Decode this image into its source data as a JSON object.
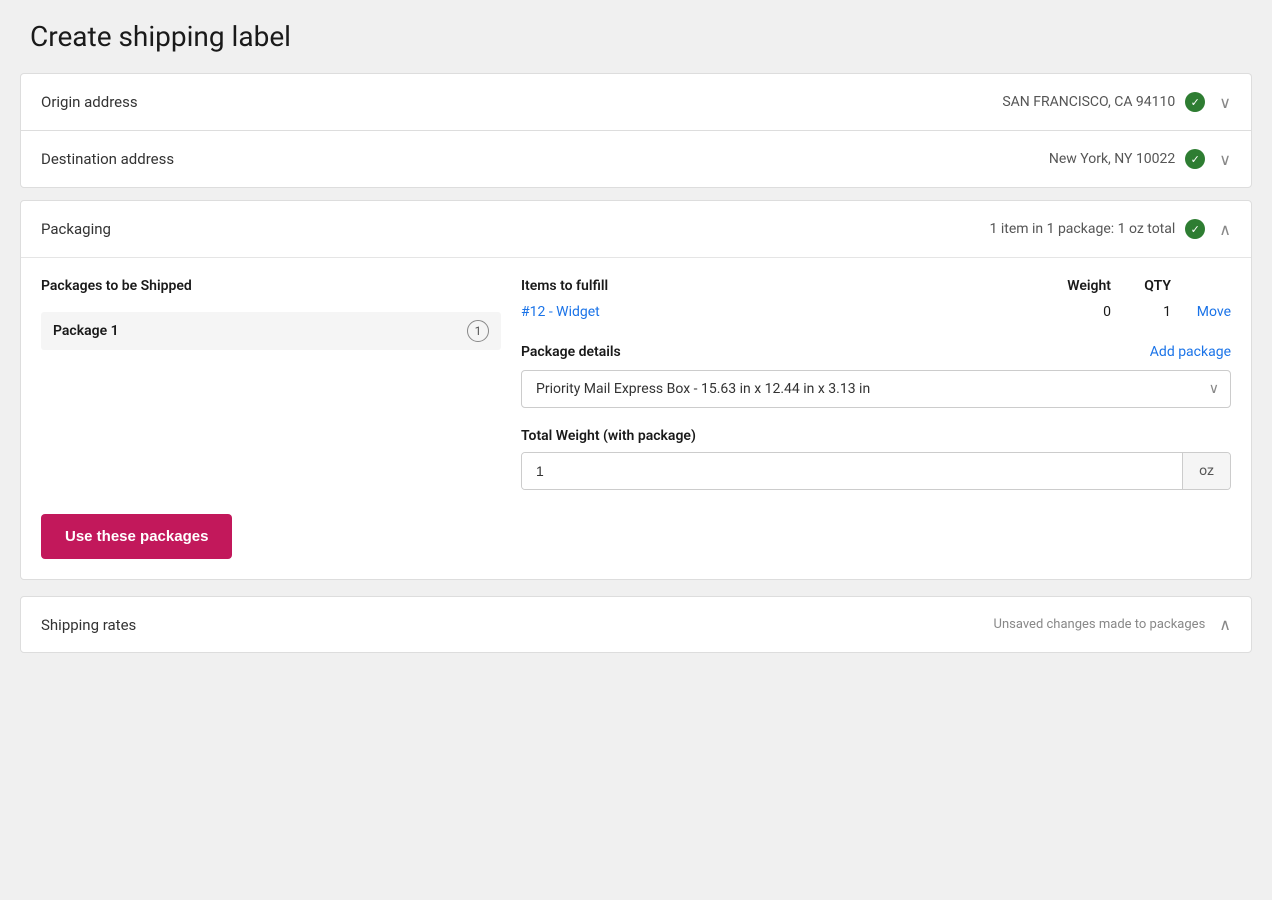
{
  "page": {
    "title": "Create shipping label"
  },
  "origin": {
    "label": "Origin address",
    "value": "SAN FRANCISCO, CA  94110",
    "verified": true
  },
  "destination": {
    "label": "Destination address",
    "value": "New York, NY  10022",
    "verified": true
  },
  "packaging": {
    "label": "Packaging",
    "summary": "1 item in 1 package: 1 oz total",
    "verified": true,
    "columns": {
      "packages": "Packages to be Shipped",
      "items": "Items to fulfill",
      "weight": "Weight",
      "qty": "QTY"
    },
    "package1": {
      "name": "Package 1",
      "badge": "1",
      "item": {
        "link": "#12 - Widget",
        "weight": "0",
        "qty": "1",
        "action": "Move"
      }
    },
    "details": {
      "label": "Package details",
      "addPackage": "Add package",
      "selectedBox": "Priority Mail Express Box - 15.63 in x 12.44 in x 3.13 in"
    },
    "totalWeight": {
      "label": "Total Weight (with package)",
      "value": "1",
      "unit": "oz"
    }
  },
  "buttons": {
    "usePackages": "Use these packages"
  },
  "shippingRates": {
    "label": "Shipping rates",
    "note": "Unsaved changes made to packages"
  }
}
